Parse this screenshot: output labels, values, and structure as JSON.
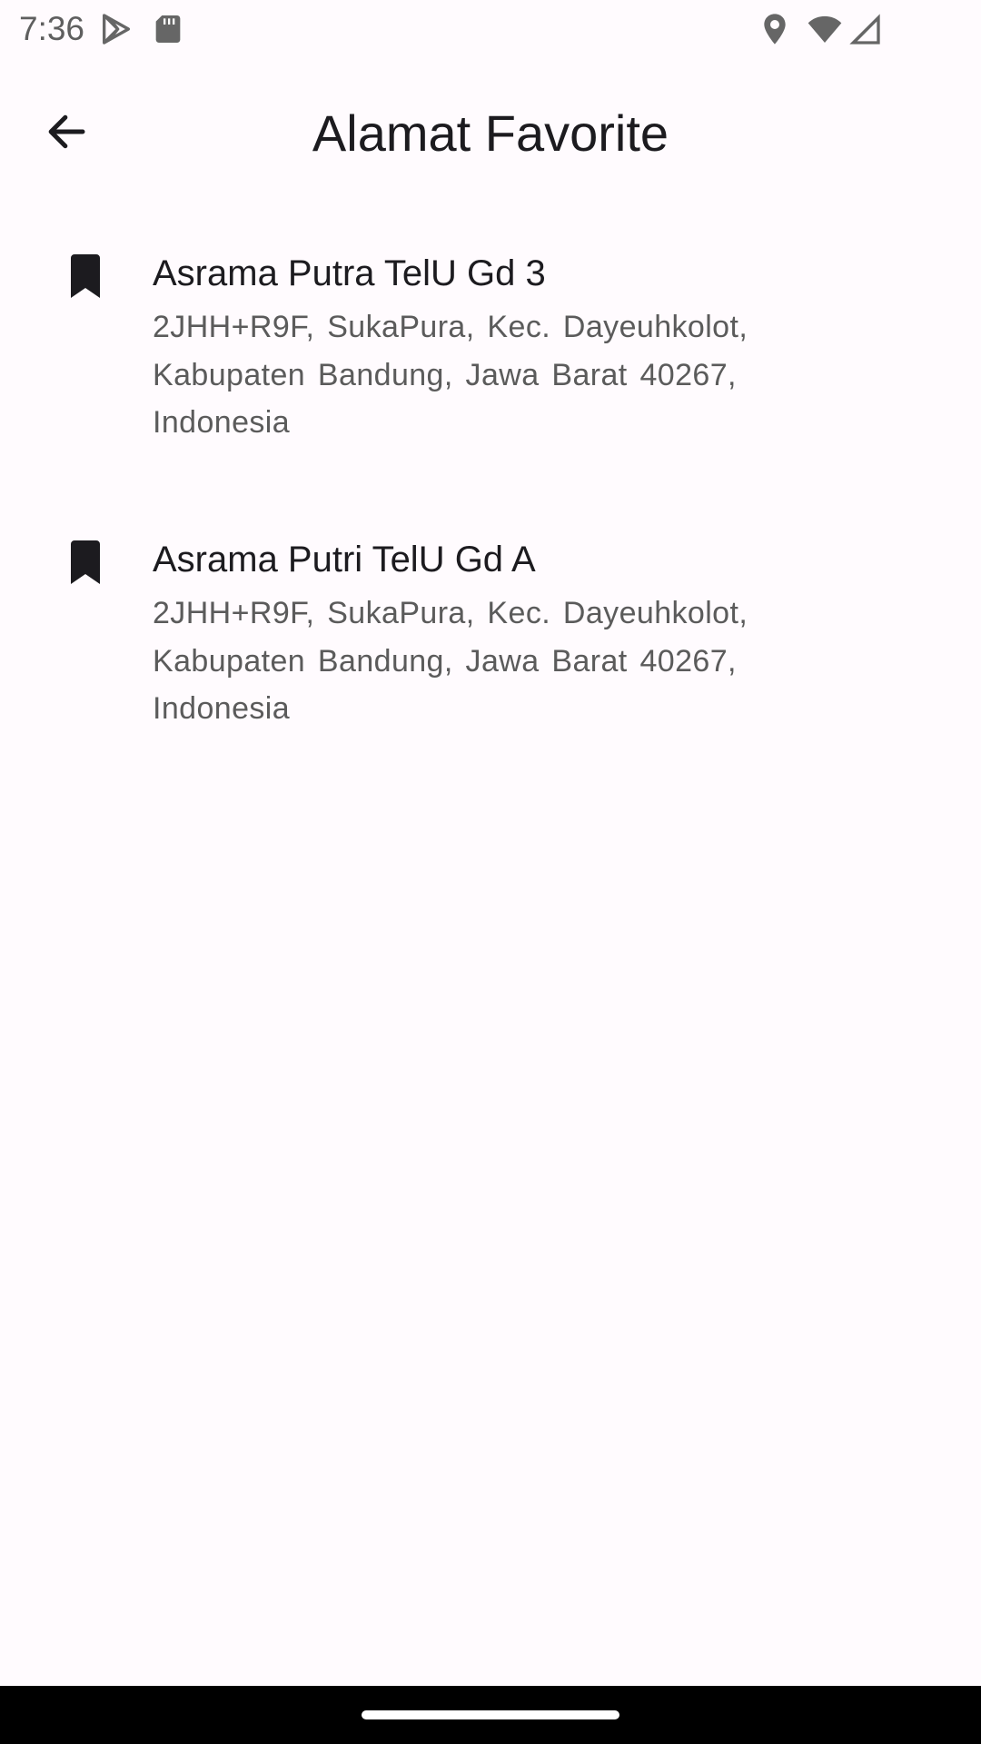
{
  "status_bar": {
    "time": "7:36",
    "icons": [
      "play-store-icon",
      "sd-card-icon",
      "location-icon",
      "wifi-icon",
      "cell-signal-icon"
    ]
  },
  "app_bar": {
    "title": "Alamat Favorite",
    "back_icon": "arrow-back-icon"
  },
  "favorites": [
    {
      "icon": "bookmark-icon",
      "name": "Asrama Putra TelU Gd 3",
      "address_lines": [
        "2JHH+R9F, SukaPura, Kec. Dayeuhkolot,",
        "Kabupaten Bandung, Jawa Barat 40267,",
        "Indonesia"
      ]
    },
    {
      "icon": "bookmark-icon",
      "name": "Asrama Putri TelU Gd A",
      "address_lines": [
        "2JHH+R9F, SukaPura, Kec. Dayeuhkolot,",
        "Kabupaten Bandung, Jawa Barat 40267,",
        "Indonesia"
      ]
    }
  ],
  "colors": {
    "background": "#fffbfe",
    "title_text": "#1c1b1f",
    "secondary_text": "#5b5b5b",
    "status_text": "#5f5f5f",
    "nav_bar": "#000000"
  }
}
